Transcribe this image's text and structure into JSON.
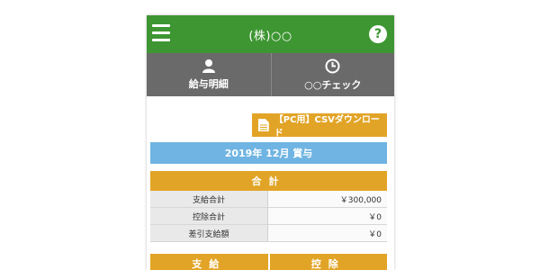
{
  "header": {
    "title": "(株)○○"
  },
  "nav": {
    "tabs": [
      {
        "label": "給与明細",
        "icon": "user-icon"
      },
      {
        "label": "○○チェック",
        "icon": "clock-icon"
      }
    ]
  },
  "csv_button": {
    "label": "【PC用】CSVダウンロード",
    "icon": "document-icon"
  },
  "period": {
    "label": "2019年 12月 賞与"
  },
  "summary": {
    "heading": "合計",
    "rows": [
      {
        "label": "支給合計",
        "value": "￥300,000"
      },
      {
        "label": "控除合計",
        "value": "￥0"
      },
      {
        "label": "差引支給額",
        "value": "￥0"
      }
    ]
  },
  "sections": {
    "left": "支給",
    "right": "控除"
  },
  "colors": {
    "header_green": "#3e9633",
    "tab_gray": "#6a6a6a",
    "accent_orange": "#e2a426",
    "period_blue": "#6fb4e2"
  }
}
